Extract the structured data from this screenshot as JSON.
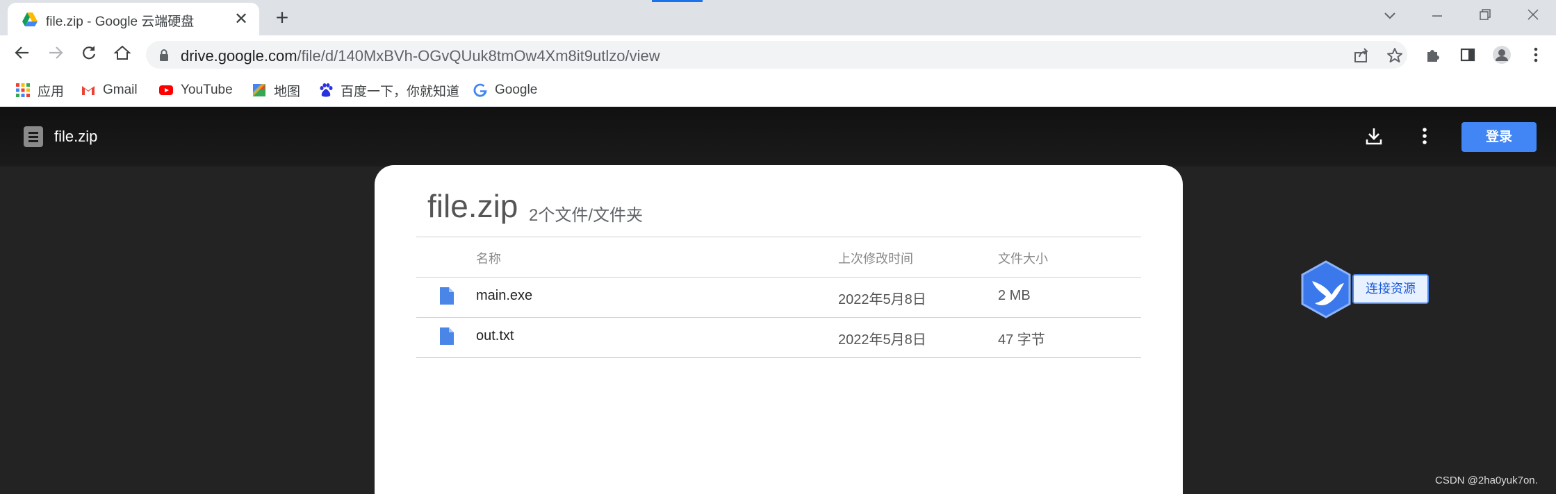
{
  "browser": {
    "tab": {
      "title": "file.zip - Google 云端硬盘",
      "close_label": "✕"
    },
    "new_tab_label": "+",
    "url": {
      "host": "drive.google.com",
      "path": "/file/d/140MxBVh-OGvQUuk8tmOw4Xm8it9utlzo/view"
    },
    "bookmarks": [
      {
        "label": "应用",
        "icon": "apps-grid-icon"
      },
      {
        "label": "Gmail",
        "icon": "gmail-icon"
      },
      {
        "label": "YouTube",
        "icon": "youtube-icon"
      },
      {
        "label": "地图",
        "icon": "maps-icon"
      },
      {
        "label": "百度一下，你就知道",
        "icon": "baidu-icon"
      },
      {
        "label": "Google",
        "icon": "google-icon"
      }
    ]
  },
  "viewer": {
    "title": "file.zip",
    "login_label": "登录"
  },
  "archive": {
    "name": "file.zip",
    "summary": "2个文件/文件夹",
    "columns": {
      "name": "名称",
      "modified": "上次修改时间",
      "size": "文件大小"
    },
    "files": [
      {
        "name": "main.exe",
        "modified": "2022年5月8日",
        "size": "2 MB"
      },
      {
        "name": "out.txt",
        "modified": "2022年5月8日",
        "size": "47 字节"
      }
    ]
  },
  "xunlei": {
    "label": "连接资源"
  },
  "watermark": "CSDN @2ha0yuk7on.",
  "colors": {
    "accent": "#4285f4",
    "tab_indicator": "#1a73e8",
    "file_icon": "#4a86e8"
  }
}
